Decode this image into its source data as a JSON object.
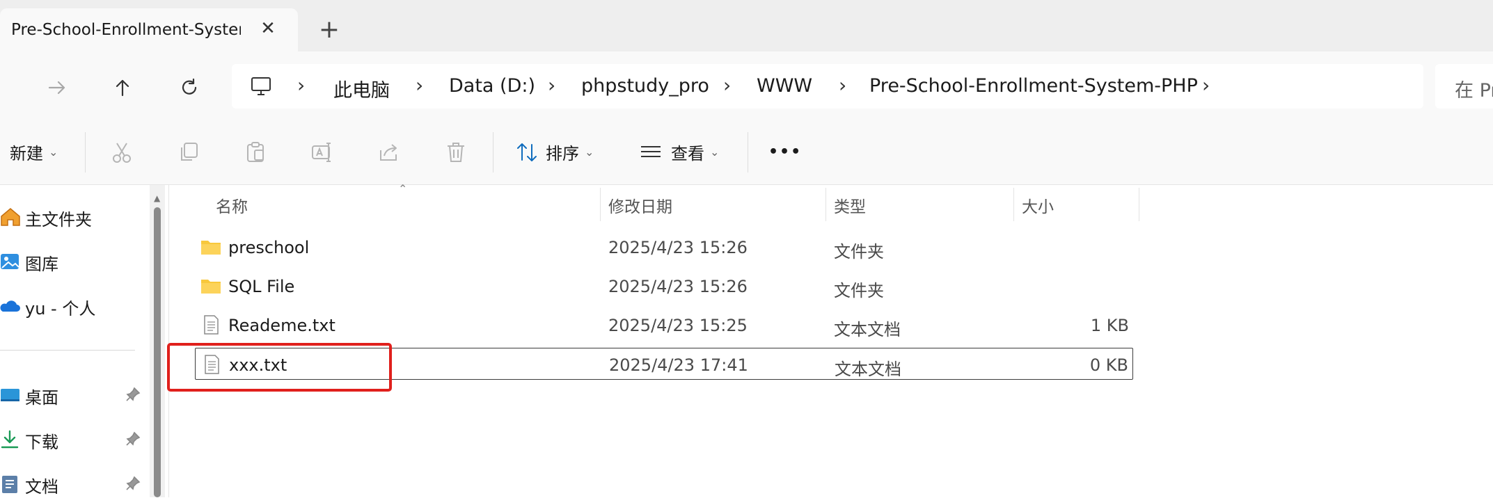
{
  "tab": {
    "title": "Pre-School-Enrollment-System-PHP",
    "close_glyph": "✕",
    "new_glyph": "+"
  },
  "breadcrumb": [
    "此电脑",
    "Data (D:)",
    "phpstudy_pro",
    "WWW",
    "Pre-School-Enrollment-System-PHP"
  ],
  "search": {
    "prefix": "在 Pr"
  },
  "commandbar": {
    "new_label": "新建",
    "sort_label": "排序",
    "view_label": "查看",
    "more_glyph": "•••"
  },
  "sidebar": {
    "top_items": [
      {
        "label": "主文件夹",
        "icon": "home-icon"
      },
      {
        "label": "图库",
        "icon": "gallery-icon"
      },
      {
        "label": "yu - 个人",
        "icon": "onedrive-cloud-icon"
      }
    ],
    "pinned_items": [
      {
        "label": "桌面",
        "icon": "desktop-icon"
      },
      {
        "label": "下载",
        "icon": "download-icon"
      },
      {
        "label": "文档",
        "icon": "document-icon"
      }
    ]
  },
  "columns": {
    "name": "名称",
    "date": "修改日期",
    "type": "类型",
    "size": "大小"
  },
  "files": [
    {
      "name": "preschool",
      "date": "2025/4/23 15:26",
      "type": "文件夹",
      "size": "",
      "kind": "folder"
    },
    {
      "name": "SQL File",
      "date": "2025/4/23 15:26",
      "type": "文件夹",
      "size": "",
      "kind": "folder"
    },
    {
      "name": "Reademe.txt",
      "date": "2025/4/23 15:25",
      "type": "文本文档",
      "size": "1 KB",
      "kind": "text"
    },
    {
      "name": "xxx.txt",
      "date": "2025/4/23 17:41",
      "type": "文本文档",
      "size": "0 KB",
      "kind": "text",
      "selected": true
    }
  ],
  "colors": {
    "folder": "#f8c83c",
    "highlight": "#e0201c",
    "accent": "#0f6cbd"
  }
}
